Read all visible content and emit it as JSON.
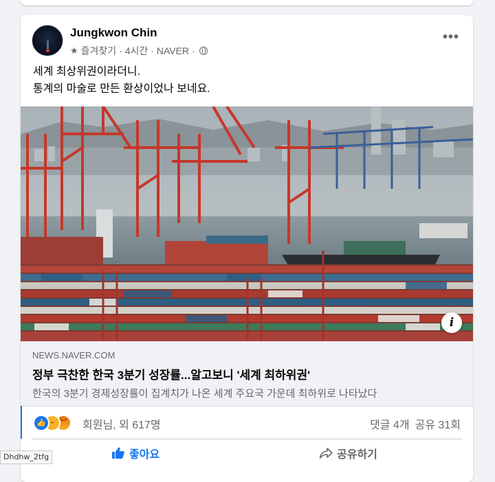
{
  "post": {
    "author": "Jungkwon Chin",
    "meta_favorites": "즐겨찾기",
    "meta_time": "· 4시간 ·",
    "meta_source": "NAVER ·",
    "caption_line1": "세계 최상위권이라더니.",
    "caption_line2": "통계의 마술로 만든 환상이었나 보네요.",
    "more_icon": "more-options-icon"
  },
  "link": {
    "domain": "NEWS.NAVER.COM",
    "title": "정부 극찬한 한국 3분기 성장률...알고보니 '세계 최하위권'",
    "description": "한국의 3분기 경제성장률이 집계치가 나온 세계 주요국 가운데 최하위로 나타났다"
  },
  "reactions": {
    "text": "회원님, 외 617명",
    "comments": "댓글 4개",
    "shares": "공유 31회"
  },
  "actions": {
    "like_label": "좋아요",
    "share_label": "공유하기"
  },
  "tooltip": "Dhdhw_2tfg",
  "colors": {
    "accent": "#1877f2",
    "muted": "#65676b"
  }
}
